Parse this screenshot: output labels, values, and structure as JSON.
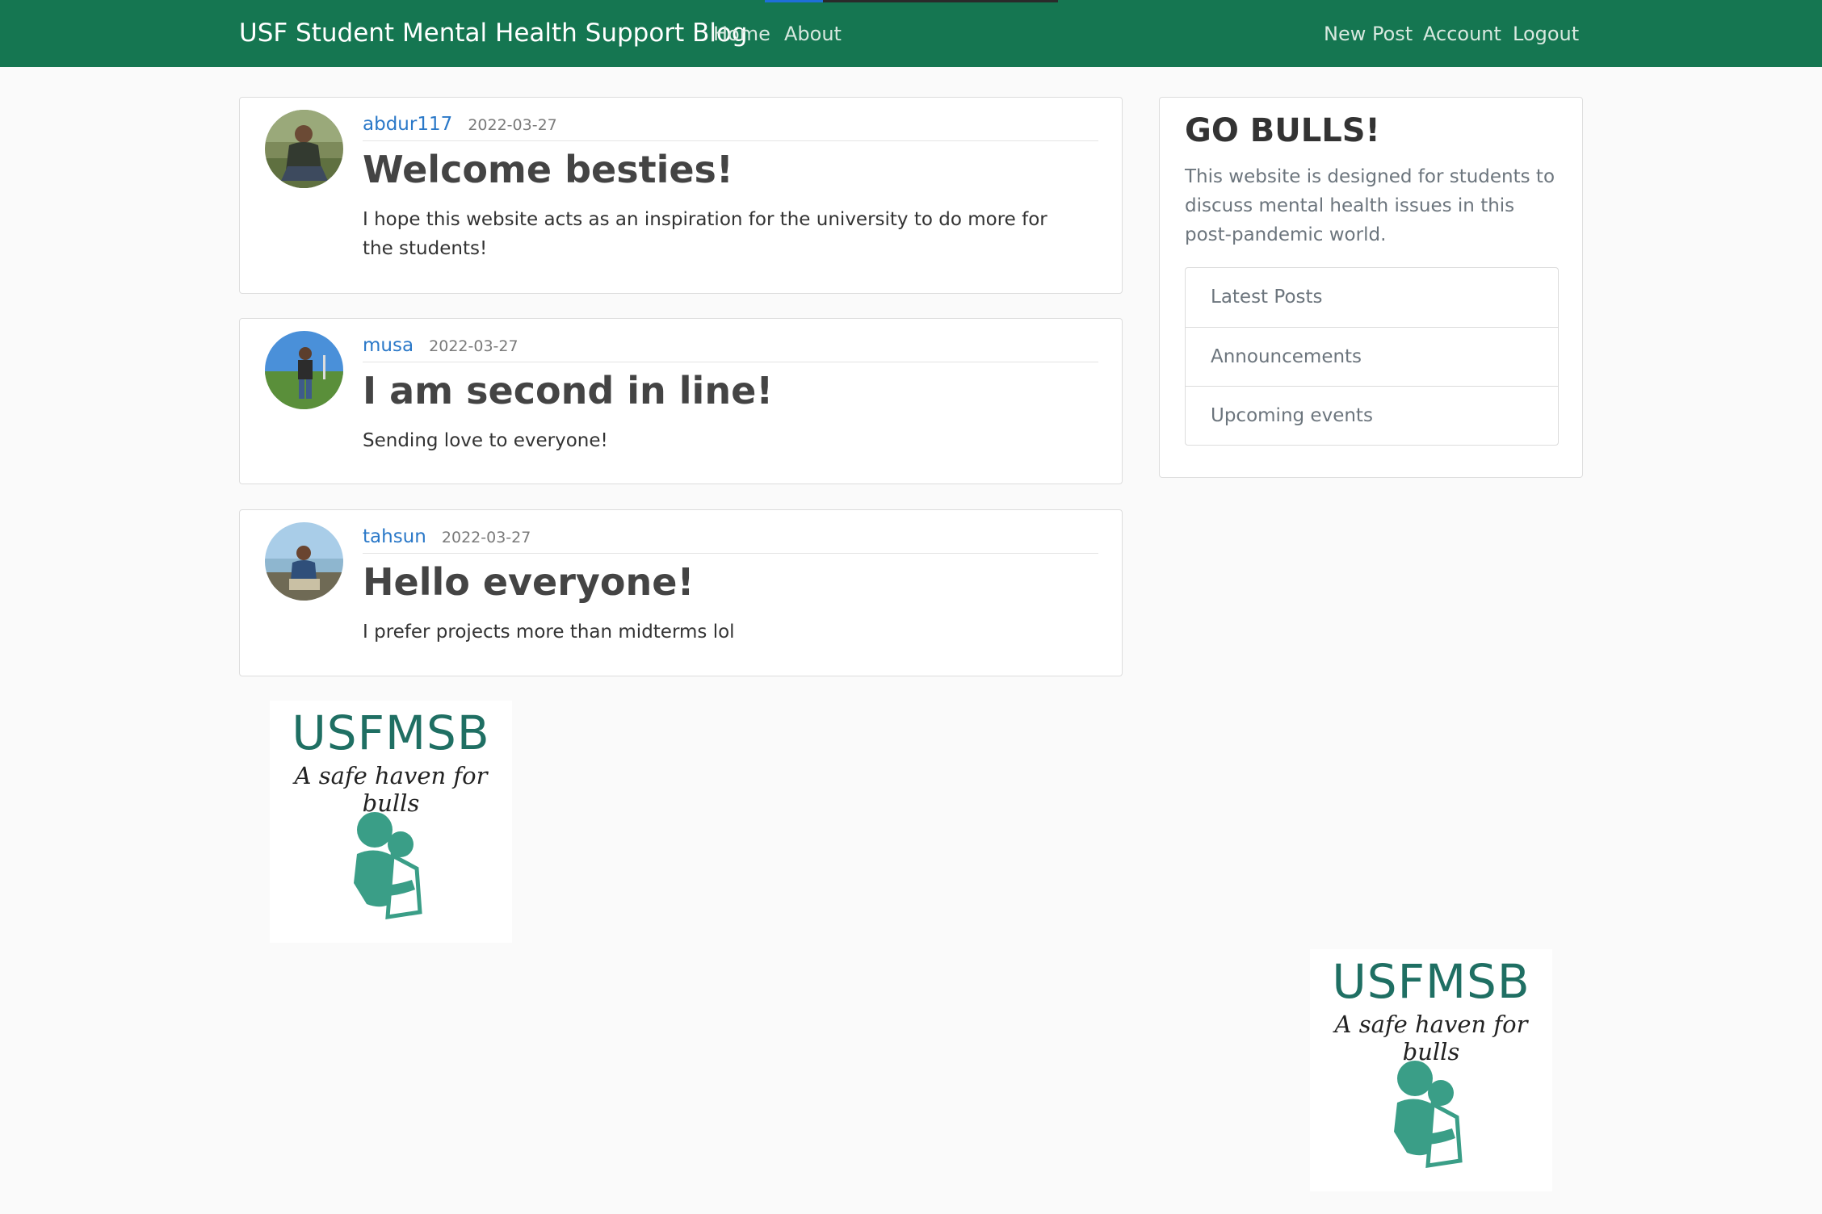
{
  "navbar": {
    "brand": "USF Student Mental Health Support Blog",
    "links": [
      "Home",
      "About"
    ],
    "right_links": [
      "New Post",
      "Account",
      "Logout"
    ],
    "bg_color": "#157651"
  },
  "posts": [
    {
      "author": "abdur117",
      "date": "2022-03-27",
      "title": "Welcome besties!",
      "content": "I hope this website acts as an inspiration for the university to do more for the students!"
    },
    {
      "author": "musa",
      "date": "2022-03-27",
      "title": "I am second in line!",
      "content": "Sending love to everyone!"
    },
    {
      "author": "tahsun",
      "date": "2022-03-27",
      "title": "Hello everyone!",
      "content": "I prefer projects more than midterms lol"
    }
  ],
  "sidebar": {
    "title": "GO BULLS!",
    "description": "This website is designed for students to discuss mental health issues in this post-pandemic world.",
    "items": [
      "Latest Posts",
      "Announcements",
      "Upcoming events"
    ]
  },
  "logo": {
    "title": "USFMSB",
    "subtitle": "A safe haven for bulls",
    "color": "#3a9e87"
  }
}
